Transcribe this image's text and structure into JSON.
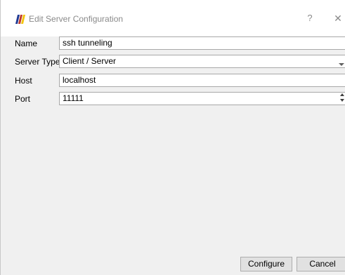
{
  "window": {
    "title": "Edit Server Configuration",
    "help_label": "?",
    "close_label": "✕",
    "app_icon": "paraview-logo-icon",
    "brand_colors": [
      "#1f3a93",
      "#c0392b",
      "#f1c40f"
    ]
  },
  "form": {
    "name": {
      "label": "Name",
      "value": "ssh tunneling"
    },
    "server_type": {
      "label": "Server Type",
      "value": "Client / Server"
    },
    "host": {
      "label": "Host",
      "value": "localhost"
    },
    "port": {
      "label": "Port",
      "value": "11111"
    }
  },
  "buttons": {
    "configure_label": "Configure",
    "cancel_label": "Cancel"
  }
}
